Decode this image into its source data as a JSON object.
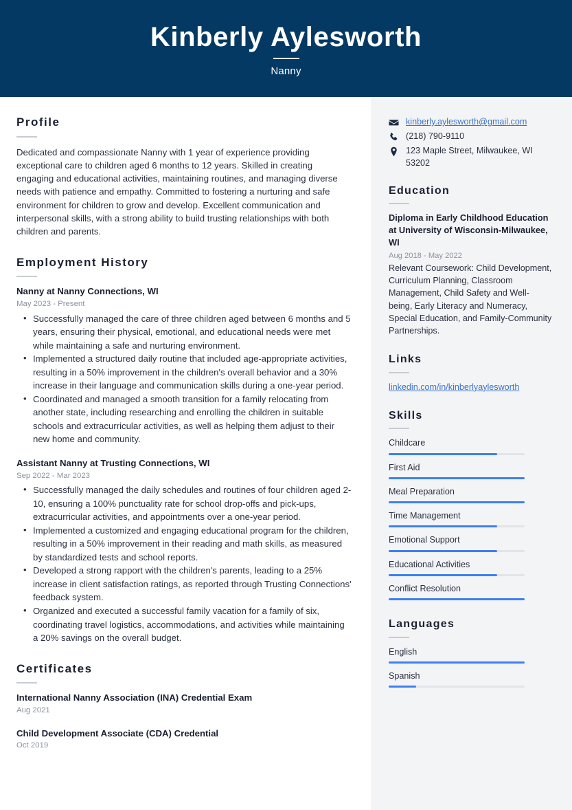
{
  "header": {
    "name": "Kinberly Aylesworth",
    "job_title": "Nanny",
    "background_color": "#043963"
  },
  "main": {
    "profile": {
      "heading": "Profile",
      "text": "Dedicated and compassionate Nanny with 1 year of experience providing exceptional care to children aged 6 months to 12 years. Skilled in creating engaging and educational activities, maintaining routines, and managing diverse needs with patience and empathy. Committed to fostering a nurturing and safe environment for children to grow and develop. Excellent communication and interpersonal skills, with a strong ability to build trusting relationships with both children and parents."
    },
    "employment": {
      "heading": "Employment History",
      "jobs": [
        {
          "title": "Nanny at Nanny Connections, WI",
          "date": "May 2023 - Present",
          "bullets": [
            "Successfully managed the care of three children aged between 6 months and 5 years, ensuring their physical, emotional, and educational needs were met while maintaining a safe and nurturing environment.",
            "Implemented a structured daily routine that included age-appropriate activities, resulting in a 50% improvement in the children's overall behavior and a 30% increase in their language and communication skills during a one-year period.",
            "Coordinated and managed a smooth transition for a family relocating from another state, including researching and enrolling the children in suitable schools and extracurricular activities, as well as helping them adjust to their new home and community."
          ]
        },
        {
          "title": "Assistant Nanny at Trusting Connections, WI",
          "date": "Sep 2022 - Mar 2023",
          "bullets": [
            "Successfully managed the daily schedules and routines of four children aged 2-10, ensuring a 100% punctuality rate for school drop-offs and pick-ups, extracurricular activities, and appointments over a one-year period.",
            "Implemented a customized and engaging educational program for the children, resulting in a 50% improvement in their reading and math skills, as measured by standardized tests and school reports.",
            "Developed a strong rapport with the children's parents, leading to a 25% increase in client satisfaction ratings, as reported through Trusting Connections' feedback system.",
            "Organized and executed a successful family vacation for a family of six, coordinating travel logistics, accommodations, and activities while maintaining a 20% savings on the overall budget."
          ]
        }
      ]
    },
    "certificates": {
      "heading": "Certificates",
      "items": [
        {
          "title": "International Nanny Association (INA) Credential Exam",
          "date": "Aug 2021"
        },
        {
          "title": "Child Development Associate (CDA) Credential",
          "date": "Oct 2019"
        }
      ]
    }
  },
  "sidebar": {
    "contact": {
      "email": "kinberly.aylesworth@gmail.com",
      "phone": "(218) 790-9110",
      "address": "123 Maple Street, Milwaukee, WI 53202",
      "email_icon": "envelope-icon",
      "phone_icon": "phone-icon",
      "address_icon": "map-pin-icon"
    },
    "education": {
      "heading": "Education",
      "items": [
        {
          "title": "Diploma in Early Childhood Education at University of Wisconsin-Milwaukee, WI",
          "date": "Aug 2018 - May 2022",
          "description": "Relevant Coursework: Child Development, Curriculum Planning, Classroom Management, Child Safety and Well-being, Early Literacy and Numeracy, Special Education, and Family-Community Partnerships."
        }
      ]
    },
    "links": {
      "heading": "Links",
      "items": [
        {
          "label": "linkedin.com/in/kinberlyaylesworth"
        }
      ]
    },
    "skills": {
      "heading": "Skills",
      "accent_color": "#3d7ff0",
      "items": [
        {
          "name": "Childcare",
          "level": 80
        },
        {
          "name": "First Aid",
          "level": 100
        },
        {
          "name": "Meal Preparation",
          "level": 100
        },
        {
          "name": "Time Management",
          "level": 80
        },
        {
          "name": "Emotional Support",
          "level": 80
        },
        {
          "name": "Educational Activities",
          "level": 80
        },
        {
          "name": "Conflict Resolution",
          "level": 100
        }
      ]
    },
    "languages": {
      "heading": "Languages",
      "items": [
        {
          "name": "English",
          "level": 100
        },
        {
          "name": "Spanish",
          "level": 20
        }
      ]
    }
  }
}
